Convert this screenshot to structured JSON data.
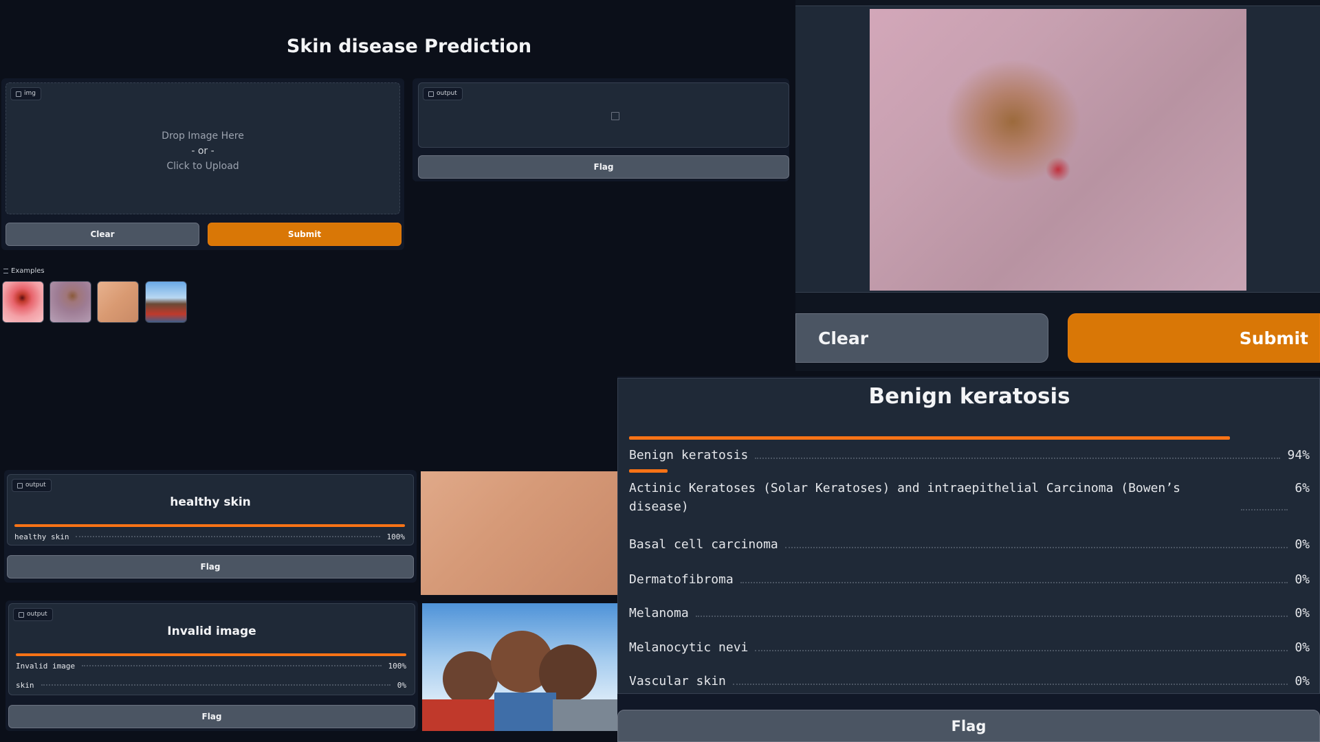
{
  "title": "Skin disease Prediction",
  "input": {
    "tag": "img",
    "drop_text": "Drop Image Here",
    "or_text": "- or -",
    "upload_text": "Click to Upload",
    "clear_label": "Clear",
    "submit_label": "Submit"
  },
  "output_top": {
    "tag": "output",
    "flag_label": "Flag"
  },
  "examples": {
    "label": "Examples",
    "items": [
      "lesion-red",
      "lesion-purple",
      "skin-tan",
      "children-photo"
    ]
  },
  "result_healthy": {
    "tag": "output",
    "heading": "healthy skin",
    "rows": [
      {
        "name": "healthy skin",
        "pct": "100%",
        "value": 1.0
      }
    ],
    "flag_label": "Flag"
  },
  "result_invalid": {
    "tag": "output",
    "heading": "Invalid image",
    "rows": [
      {
        "name": "Invalid image",
        "pct": "100%",
        "value": 1.0
      },
      {
        "name": "skin",
        "pct": "0%",
        "value": 0.0
      }
    ],
    "flag_label": "Flag"
  },
  "zoom": {
    "clear_label": "Clear",
    "submit_label": "Submit",
    "heading": "Benign keratosis",
    "rows": [
      {
        "name": "Benign keratosis",
        "pct": "94%",
        "value": 0.94
      },
      {
        "name": "Actinic Keratoses (Solar Keratoses) and intraepithelial Carcinoma (Bowen’s disease)",
        "pct": "6%",
        "value": 0.06
      },
      {
        "name": "Basal cell carcinoma",
        "pct": "0%",
        "value": 0.0
      },
      {
        "name": "Dermatofibroma",
        "pct": "0%",
        "value": 0.0
      },
      {
        "name": "Melanoma",
        "pct": "0%",
        "value": 0.0
      },
      {
        "name": "Melanocytic nevi",
        "pct": "0%",
        "value": 0.0
      },
      {
        "name": "Vascular skin",
        "pct": "0%",
        "value": 0.0
      }
    ],
    "flag_label": "Flag"
  },
  "colors": {
    "background": "#0b0f19",
    "block": "#1f2937",
    "accent": "#d97706",
    "bar": "#f97316"
  }
}
